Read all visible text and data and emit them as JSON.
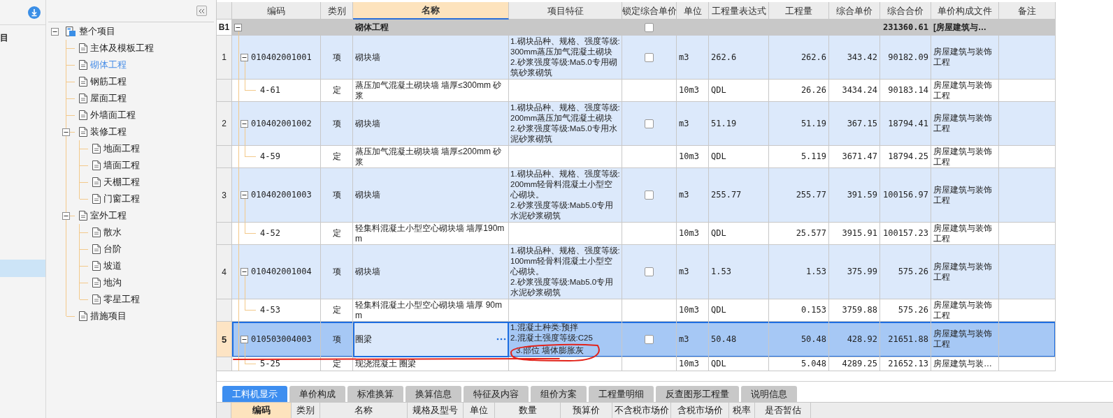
{
  "left_panel": {
    "items": [
      {
        "label": "目",
        "selected": false
      },
      {
        "selected": true
      }
    ]
  },
  "tree": {
    "label": "整个项目",
    "expanded": true,
    "selected": false,
    "children": [
      {
        "label": "主体及模板工程",
        "selected": false
      },
      {
        "label": "砌体工程",
        "selected": true
      },
      {
        "label": "钢筋工程",
        "selected": false
      },
      {
        "label": "屋面工程",
        "selected": false
      },
      {
        "label": "外墙面工程",
        "selected": false
      },
      {
        "label": "装修工程",
        "selected": false,
        "expanded": true,
        "children": [
          {
            "label": "地面工程",
            "selected": false
          },
          {
            "label": "墙面工程",
            "selected": false
          },
          {
            "label": "天棚工程",
            "selected": false
          },
          {
            "label": "门窗工程",
            "selected": false
          }
        ]
      },
      {
        "label": "室外工程",
        "selected": false,
        "expanded": true,
        "children": [
          {
            "label": "散水",
            "selected": false
          },
          {
            "label": "台阶",
            "selected": false
          },
          {
            "label": "坡道",
            "selected": false
          },
          {
            "label": "地沟",
            "selected": false
          },
          {
            "label": "零星工程",
            "selected": false
          }
        ]
      },
      {
        "label": "措施项目",
        "selected": false
      }
    ]
  },
  "table": {
    "columns": [
      {
        "label": "编码",
        "selected": false
      },
      {
        "label": "类别",
        "selected": false
      },
      {
        "label": "名称",
        "selected": true
      },
      {
        "label": "项目特征",
        "selected": false
      },
      {
        "label": "锁定综合单价",
        "selected": false
      },
      {
        "label": "单位",
        "selected": false
      },
      {
        "label": "工程量表达式",
        "selected": false
      },
      {
        "label": "工程量",
        "selected": false
      },
      {
        "label": "综合单价",
        "selected": false
      },
      {
        "label": "综合合价",
        "selected": false
      },
      {
        "label": "单价构成文件",
        "selected": false
      },
      {
        "label": "备注",
        "selected": false
      }
    ],
    "rows": [
      {
        "kind": "group",
        "number": "B1",
        "expanded": true,
        "name": "砌体工程",
        "locked": false,
        "total": "231360.61",
        "file": "[房屋建筑与…",
        "children": [
          {
            "kind": "item",
            "number": "1",
            "selected": false,
            "expanded": true,
            "code": "010402001001",
            "type": "项",
            "name": "砌块墙",
            "features": [
              "1.砌块品种、规格、强度等级:300mm蒸压加气混凝土砌块",
              "2.砂浆强度等级:Ma5.0专用砌筑砂浆砌筑"
            ],
            "locked": false,
            "unit": "m3",
            "expression": "262.6",
            "quantity": "262.6",
            "unit_price": "343.42",
            "total": "90182.09",
            "file": "房屋建筑与装饰工程",
            "children": [
              {
                "kind": "norm",
                "code": "4-61",
                "type": "定",
                "name": "蒸压加气混凝土砌块墙 墙厚≤300mm 砂浆",
                "unit": "10m3",
                "expression": "QDL",
                "quantity": "26.26",
                "unit_price": "3434.24",
                "total": "90183.14",
                "file": "房屋建筑与装饰工程"
              }
            ]
          },
          {
            "kind": "item",
            "number": "2",
            "selected": false,
            "expanded": true,
            "code": "010402001002",
            "type": "项",
            "name": "砌块墙",
            "features": [
              "1.砌块品种、规格、强度等级:200mm蒸压加气混凝土砌块",
              "2.砂浆强度等级:Ma5.0专用水泥砂浆砌筑"
            ],
            "locked": false,
            "unit": "m3",
            "expression": "51.19",
            "quantity": "51.19",
            "unit_price": "367.15",
            "total": "18794.41",
            "file": "房屋建筑与装饰工程",
            "children": [
              {
                "kind": "norm",
                "code": "4-59",
                "type": "定",
                "name": "蒸压加气混凝土砌块墙 墙厚≤200mm 砂浆",
                "unit": "10m3",
                "expression": "QDL",
                "quantity": "5.119",
                "unit_price": "3671.47",
                "total": "18794.25",
                "file": "房屋建筑与装饰工程"
              }
            ]
          },
          {
            "kind": "item",
            "number": "3",
            "selected": false,
            "expanded": true,
            "code": "010402001003",
            "type": "项",
            "name": "砌块墙",
            "features": [
              "1.砌块品种、规格、强度等级:200mm轻骨料混凝土小型空心砌块。",
              "2.砂浆强度等级:Mab5.0专用水泥砂浆砌筑"
            ],
            "locked": false,
            "unit": "m3",
            "expression": "255.77",
            "quantity": "255.77",
            "unit_price": "391.59",
            "total": "100156.97",
            "file": "房屋建筑与装饰工程",
            "children": [
              {
                "kind": "norm",
                "code": "4-52",
                "type": "定",
                "name": "轻集料混凝土小型空心砌块墙 墙厚190mm",
                "unit": "10m3",
                "expression": "QDL",
                "quantity": "25.577",
                "unit_price": "3915.91",
                "total": "100157.23",
                "file": "房屋建筑与装饰工程"
              }
            ]
          },
          {
            "kind": "item",
            "number": "4",
            "selected": false,
            "expanded": true,
            "code": "010402001004",
            "type": "项",
            "name": "砌块墙",
            "features": [
              "1.砌块品种、规格、强度等级:100mm轻骨料混凝土小型空心砌块。",
              "2.砂浆强度等级:Mab5.0专用水泥砂浆砌筑"
            ],
            "locked": false,
            "unit": "m3",
            "expression": "1.53",
            "quantity": "1.53",
            "unit_price": "375.99",
            "total": "575.26",
            "file": "房屋建筑与装饰工程",
            "children": [
              {
                "kind": "norm",
                "code": "4-53",
                "type": "定",
                "name": "轻集料混凝土小型空心砌块墙 墙厚 90mm",
                "unit": "10m3",
                "expression": "QDL",
                "quantity": "0.153",
                "unit_price": "3759.88",
                "total": "575.26",
                "file": "房屋建筑与装饰工程"
              }
            ]
          },
          {
            "kind": "item",
            "number": "5",
            "selected": true,
            "expanded": true,
            "code": "010503004003",
            "type": "项",
            "name": "圈梁",
            "features": [
              "1.混凝土种类:预拌",
              "2.混凝土强度等级:C25",
              "3.部位 墙体膨胀灰"
            ],
            "locked": false,
            "unit": "m3",
            "expression": "50.48",
            "quantity": "50.48",
            "unit_price": "428.92",
            "total": "21651.88",
            "file": "房屋建筑与装饰工程",
            "children": [
              {
                "kind": "norm",
                "code": "5-25",
                "type": "定",
                "name": "现浇混凝土 圈梁",
                "unit": "10m3",
                "expression": "QDL",
                "quantity": "5.048",
                "unit_price": "4289.25",
                "total": "21652.13",
                "file": "房屋建筑与装…"
              }
            ]
          }
        ]
      }
    ]
  },
  "bottom_tabs": [
    {
      "label": "工料机显示",
      "selected": true
    },
    {
      "label": "单价构成",
      "selected": false
    },
    {
      "label": "标准换算",
      "selected": false
    },
    {
      "label": "换算信息",
      "selected": false
    },
    {
      "label": "特征及内容",
      "selected": false
    },
    {
      "label": "组价方案",
      "selected": false
    },
    {
      "label": "工程量明细",
      "selected": false
    },
    {
      "label": "反查图形工程量",
      "selected": false
    },
    {
      "label": "说明信息",
      "selected": false
    }
  ],
  "bottom_columns": [
    {
      "label": "编码",
      "selected": true
    },
    {
      "label": "类别",
      "selected": false
    },
    {
      "label": "名称",
      "selected": false
    },
    {
      "label": "规格及型号",
      "selected": false
    },
    {
      "label": "单位",
      "selected": false
    },
    {
      "label": "数量",
      "selected": false
    },
    {
      "label": "预算价",
      "selected": false
    },
    {
      "label": "不含税市场价",
      "selected": false
    },
    {
      "label": "含税市场价",
      "selected": false
    },
    {
      "label": "税率",
      "selected": false
    },
    {
      "label": "是否暂估",
      "selected": false
    }
  ]
}
